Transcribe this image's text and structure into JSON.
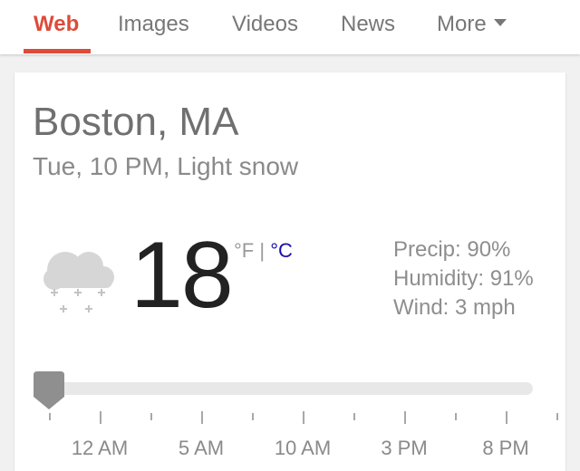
{
  "tabs": [
    {
      "label": "Web",
      "active": true
    },
    {
      "label": "Images",
      "active": false
    },
    {
      "label": "Videos",
      "active": false
    },
    {
      "label": "News",
      "active": false
    },
    {
      "label": "More",
      "active": false
    }
  ],
  "weather": {
    "location": "Boston, MA",
    "subtitle": "Tue, 10 PM, Light snow",
    "condition_icon": "snow-cloud-icon",
    "temperature": "18",
    "unit_f": "°F",
    "unit_separator": "|",
    "unit_c": "°C",
    "precip": "Precip: 90%",
    "humidity": "Humidity: 91%",
    "wind": "Wind: 3 mph"
  },
  "timeline": {
    "labels": [
      "12 AM",
      "5 AM",
      "10 AM",
      "3 PM",
      "8 PM"
    ],
    "selected_fraction": 0
  },
  "colors": {
    "accent": "#dd4b39",
    "link": "#1a0dab"
  }
}
